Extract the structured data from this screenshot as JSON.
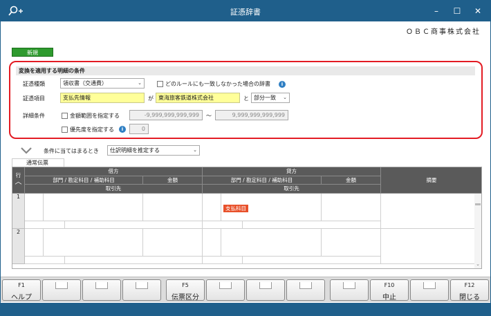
{
  "window": {
    "title": "証憑辞書"
  },
  "company": "ＯＢＣ商事株式会社",
  "tab_new": "新規",
  "conditions": {
    "header": "変換を適用する明細の条件",
    "voucher_type_label": "証憑種類",
    "voucher_type_value": "領収書（交通費）",
    "no_match_label": "どのルールにも一致しなかった場合の辞書",
    "item_label": "証憑項目",
    "item_value": "支払先情報",
    "ga": "が",
    "match_value": "東海旅客鉄道株式会社",
    "to": "と",
    "match_mode": "部分一致",
    "detail_label": "詳細条件",
    "amount_label": "金額範囲を指定する",
    "amount_from": "-9,999,999,999,999",
    "tilde": "～",
    "amount_to": "9,999,999,999,999",
    "priority_label": "優先度を指定する",
    "priority_value": "0"
  },
  "rule_bar": {
    "when_label": "条件に当てはまるとき",
    "action_value": "仕訳明細を推定する"
  },
  "subtab": "通常伝票",
  "grid": {
    "row_header": "行",
    "debit": "借方",
    "credit": "貸方",
    "account": "部門 / 勘定科目 / 補助科目",
    "amount": "金額",
    "partner": "取引先",
    "memo": "摘要",
    "rows": [
      "1",
      "2"
    ],
    "badge": "支払科目"
  },
  "fkeys": [
    {
      "key": "F1",
      "name": "ヘルプ"
    },
    {
      "key": "",
      "name": ""
    },
    {
      "key": "",
      "name": ""
    },
    {
      "key": "",
      "name": ""
    },
    {
      "key": "F5",
      "name": "伝票区分"
    },
    {
      "key": "",
      "name": ""
    },
    {
      "key": "",
      "name": ""
    },
    {
      "key": "",
      "name": ""
    },
    {
      "key": "",
      "name": ""
    },
    {
      "key": "F10",
      "name": "中止"
    },
    {
      "key": "",
      "name": ""
    },
    {
      "key": "F12",
      "name": "閉じる"
    }
  ],
  "colors": {
    "titlebar": "#1f5f8b",
    "highlight_border": "#e31b23",
    "new_tab": "#2e9a2e",
    "badge": "#e8502a",
    "yellow_field": "#ffff99"
  }
}
